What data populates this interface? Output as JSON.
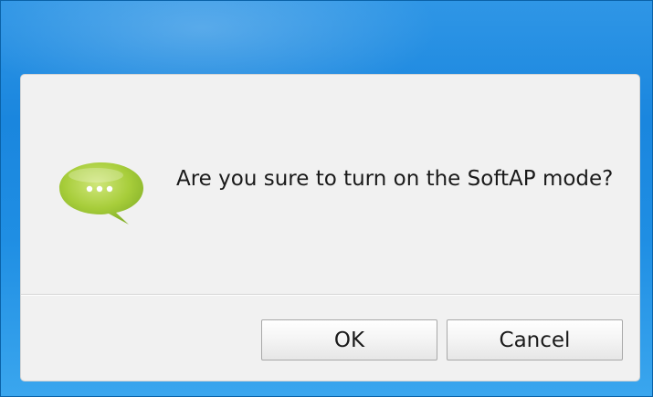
{
  "dialog": {
    "message": "Are you sure to turn on the SoftAP mode?",
    "icon": "speech-bubble-icon",
    "icon_color": "#a7cd3a",
    "ok_label": "OK",
    "cancel_label": "Cancel"
  }
}
